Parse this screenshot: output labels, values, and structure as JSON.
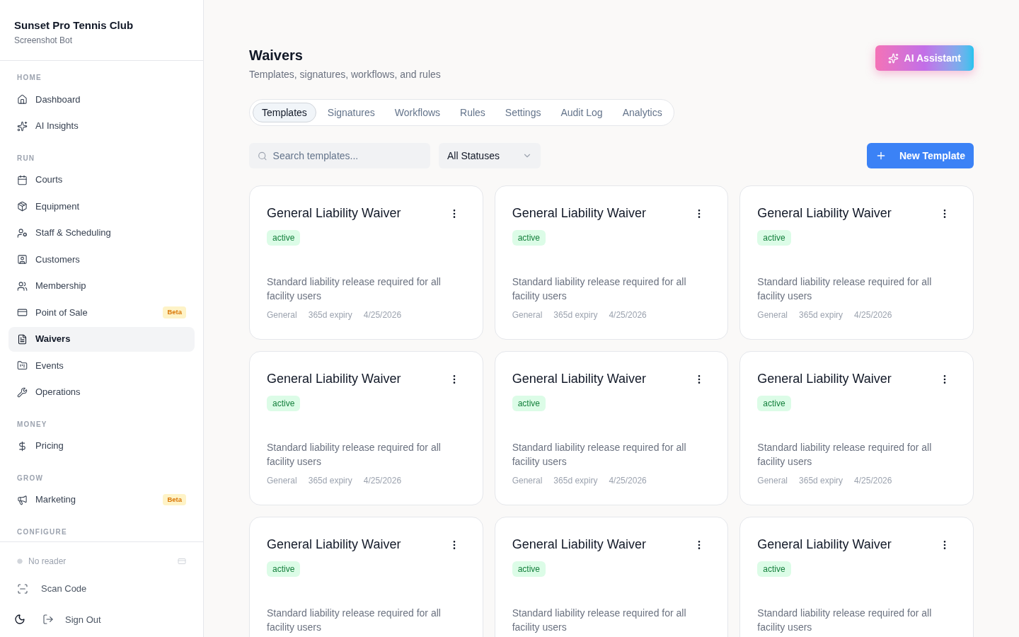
{
  "sidebar": {
    "club": "Sunset Pro Tennis Club",
    "user": "Screenshot Bot",
    "sections": [
      {
        "heading": "HOME",
        "items": [
          {
            "label": "Dashboard",
            "selected": false
          },
          {
            "label": "AI Insights",
            "selected": false
          }
        ]
      },
      {
        "heading": "RUN",
        "items": [
          {
            "label": "Courts",
            "selected": false
          },
          {
            "label": "Equipment",
            "selected": false
          },
          {
            "label": "Staff & Scheduling",
            "selected": false
          },
          {
            "label": "Customers",
            "selected": false
          },
          {
            "label": "Membership",
            "selected": false
          },
          {
            "label": "Point of Sale",
            "selected": false,
            "badge": "Beta"
          },
          {
            "label": "Waivers",
            "selected": true
          },
          {
            "label": "Events",
            "selected": false
          },
          {
            "label": "Operations",
            "selected": false
          }
        ]
      },
      {
        "heading": "MONEY",
        "items": [
          {
            "label": "Pricing",
            "selected": false
          }
        ]
      },
      {
        "heading": "GROW",
        "items": [
          {
            "label": "Marketing",
            "selected": false,
            "badge": "Beta"
          }
        ]
      },
      {
        "heading": "CONFIGURE"
      }
    ],
    "reader": "No reader",
    "scan": "Scan Code",
    "sign_out": "Sign Out"
  },
  "page": {
    "title": "Waivers",
    "subtitle": "Templates, signatures, workflows, and rules",
    "ai_button": "AI Assistant",
    "tabs": [
      {
        "label": "Templates",
        "selected": true
      },
      {
        "label": "Signatures",
        "selected": false
      },
      {
        "label": "Workflows",
        "selected": false
      },
      {
        "label": "Rules",
        "selected": false
      },
      {
        "label": "Settings",
        "selected": false
      },
      {
        "label": "Audit Log",
        "selected": false
      },
      {
        "label": "Analytics",
        "selected": false
      }
    ],
    "search": {
      "placeholder": "Search templates..."
    },
    "status_filter": "All Statuses",
    "new_button": "New Template",
    "cards": [
      {
        "title": "General Liability Waiver",
        "status": "active",
        "description": "Standard liability release required for all facility users",
        "meta": [
          "General",
          "365d expiry",
          "4/25/2026"
        ]
      },
      {
        "title": "General Liability Waiver",
        "status": "active",
        "description": "Standard liability release required for all facility users",
        "meta": [
          "General",
          "365d expiry",
          "4/25/2026"
        ]
      },
      {
        "title": "General Liability Waiver",
        "status": "active",
        "description": "Standard liability release required for all facility users",
        "meta": [
          "General",
          "365d expiry",
          "4/25/2026"
        ]
      },
      {
        "title": "General Liability Waiver",
        "status": "active",
        "description": "Standard liability release required for all facility users",
        "meta": [
          "General",
          "365d expiry",
          "4/25/2026"
        ]
      },
      {
        "title": "General Liability Waiver",
        "status": "active",
        "description": "Standard liability release required for all facility users",
        "meta": [
          "General",
          "365d expiry",
          "4/25/2026"
        ]
      },
      {
        "title": "General Liability Waiver",
        "status": "active",
        "description": "Standard liability release required for all facility users",
        "meta": [
          "General",
          "365d expiry",
          "4/25/2026"
        ]
      },
      {
        "title": "General Liability Waiver",
        "status": "active",
        "description": "Standard liability release required for all facility users"
      },
      {
        "title": "General Liability Waiver",
        "status": "active",
        "description": "Standard liability release required for all facility users"
      },
      {
        "title": "General Liability Waiver",
        "status": "active",
        "description": "Standard liability release required for all facility users"
      }
    ]
  }
}
